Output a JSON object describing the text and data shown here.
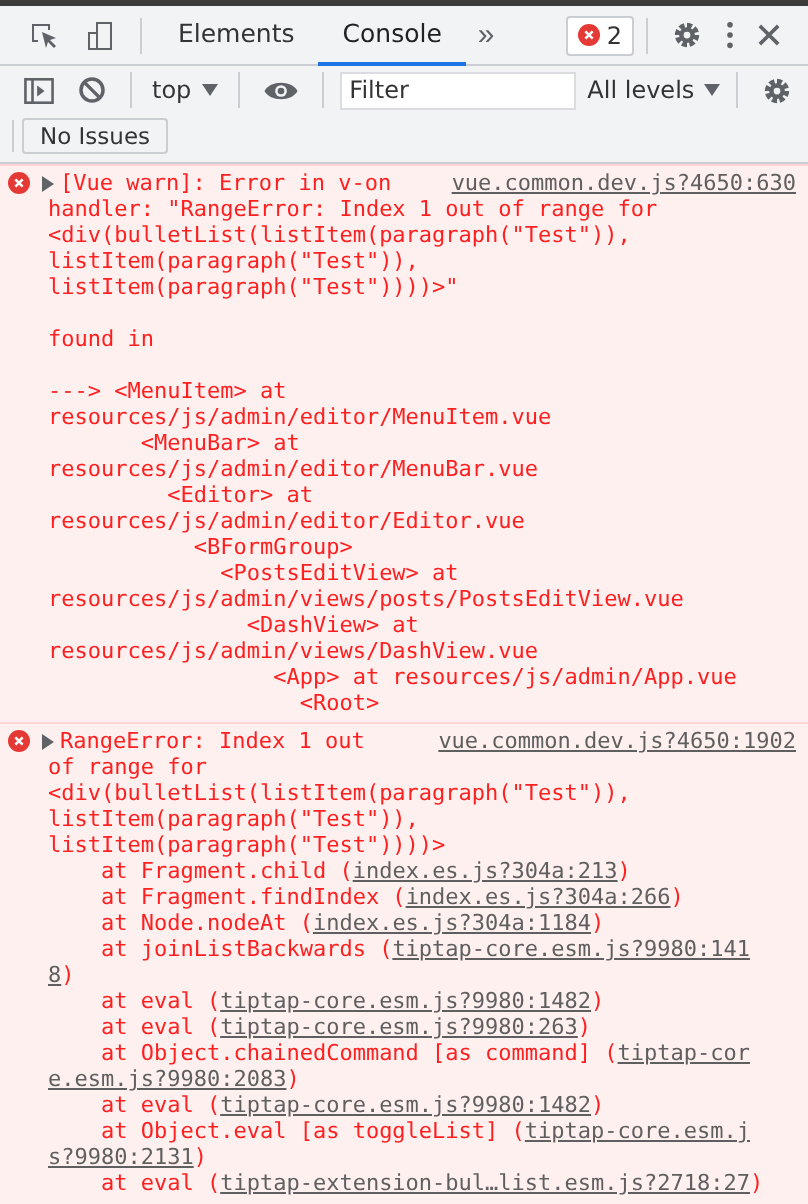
{
  "toolbar": {
    "tabs": [
      {
        "label": "Elements",
        "selected": false
      },
      {
        "label": "Console",
        "selected": true
      }
    ],
    "more": "»",
    "error_count": "2"
  },
  "console_bar": {
    "context": "top",
    "filter": {
      "placeholder": "Filter"
    },
    "levels": "All levels"
  },
  "issues": {
    "label": "No Issues"
  },
  "messages": [
    {
      "expanded": false,
      "summary": "[Vue warn]: Error in v-on",
      "source": "vue.common.dev.js?4650:630",
      "paragraphs": [
        [
          [
            {
              "text": "handler: \"RangeError: Index 1 out of range for"
            }
          ],
          [
            {
              "text": "<div(bulletList(listItem(paragraph(\"Test\")),"
            }
          ],
          [
            {
              "text": "listItem(paragraph(\"Test\")),"
            }
          ],
          [
            {
              "text": "listItem(paragraph(\"Test\"))))>\""
            }
          ]
        ],
        [
          [
            {
              "text": "found in"
            }
          ]
        ],
        [
          [
            {
              "text": "---> <MenuItem> at"
            }
          ],
          [
            {
              "text": "resources/js/admin/editor/MenuItem.vue"
            }
          ],
          [
            {
              "text": "       <MenuBar> at"
            }
          ],
          [
            {
              "text": "resources/js/admin/editor/MenuBar.vue"
            }
          ],
          [
            {
              "text": "         <Editor> at"
            }
          ],
          [
            {
              "text": "resources/js/admin/editor/Editor.vue"
            }
          ],
          [
            {
              "text": "           <BFormGroup>"
            }
          ],
          [
            {
              "text": "             <PostsEditView> at"
            }
          ],
          [
            {
              "text": "resources/js/admin/views/posts/PostsEditView.vue"
            }
          ],
          [
            {
              "text": "               <DashView> at"
            }
          ],
          [
            {
              "text": "resources/js/admin/views/DashView.vue"
            }
          ],
          [
            {
              "text": "                 <App> at resources/js/admin/App.vue"
            }
          ],
          [
            {
              "text": "                   <Root>"
            }
          ]
        ]
      ]
    },
    {
      "expanded": false,
      "summary": "RangeError: Index 1 out",
      "source": "vue.common.dev.js?4650:1902",
      "paragraphs": [
        [
          [
            {
              "text": "of range for"
            }
          ],
          [
            {
              "text": "<div(bulletList(listItem(paragraph(\"Test\")),"
            }
          ],
          [
            {
              "text": "listItem(paragraph(\"Test\")),"
            }
          ],
          [
            {
              "text": "listItem(paragraph(\"Test\"))))>"
            }
          ],
          [
            {
              "text": "    at Fragment.child ("
            },
            {
              "link": "index.es.js?304a:213"
            },
            {
              "text": ")"
            }
          ],
          [
            {
              "text": "    at Fragment.findIndex ("
            },
            {
              "link": "index.es.js?304a:266"
            },
            {
              "text": ")"
            }
          ],
          [
            {
              "text": "    at Node.nodeAt ("
            },
            {
              "link": "index.es.js?304a:1184"
            },
            {
              "text": ")"
            }
          ],
          [
            {
              "text": "    at joinListBackwards ("
            },
            {
              "link": "tiptap-core.esm.js?9980:141"
            }
          ],
          [
            {
              "link": "8"
            },
            {
              "text": ")"
            }
          ],
          [
            {
              "text": "    at eval ("
            },
            {
              "link": "tiptap-core.esm.js?9980:1482"
            },
            {
              "text": ")"
            }
          ],
          [
            {
              "text": "    at eval ("
            },
            {
              "link": "tiptap-core.esm.js?9980:263"
            },
            {
              "text": ")"
            }
          ],
          [
            {
              "text": "    at Object.chainedCommand [as command] ("
            },
            {
              "link": "tiptap-cor"
            }
          ],
          [
            {
              "link": "e.esm.js?9980:2083"
            },
            {
              "text": ")"
            }
          ],
          [
            {
              "text": "    at eval ("
            },
            {
              "link": "tiptap-core.esm.js?9980:1482"
            },
            {
              "text": ")"
            }
          ],
          [
            {
              "text": "    at Object.eval [as toggleList] ("
            },
            {
              "link": "tiptap-core.esm.j"
            }
          ],
          [
            {
              "link": "s?9980:2131"
            },
            {
              "text": ")"
            }
          ],
          [
            {
              "text": "    at eval ("
            },
            {
              "link": "tiptap-extension-bul…list.esm.js?2718:27"
            },
            {
              "text": ")"
            }
          ]
        ]
      ]
    }
  ]
}
